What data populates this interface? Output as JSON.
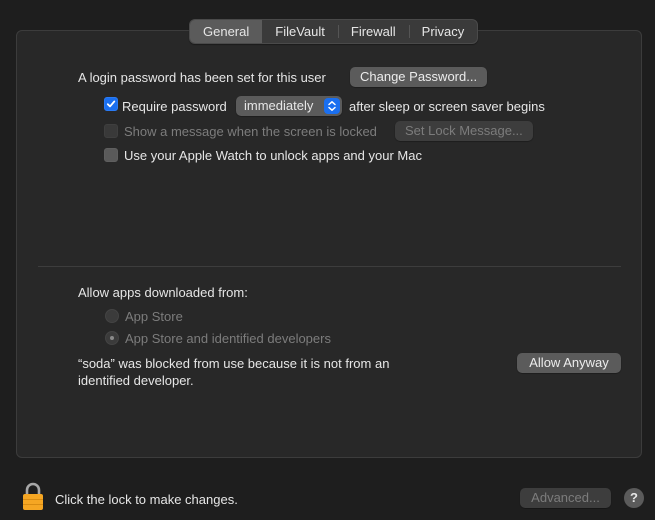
{
  "tabs": [
    {
      "label": "General",
      "active": true
    },
    {
      "label": "FileVault",
      "active": false
    },
    {
      "label": "Firewall",
      "active": false
    },
    {
      "label": "Privacy",
      "active": false
    }
  ],
  "general": {
    "login_password_text": "A login password has been set for this user",
    "change_password_button": "Change Password...",
    "require_password": {
      "label": "Require password",
      "checked": true,
      "interval": "immediately",
      "suffix": "after sleep or screen saver begins"
    },
    "show_message": {
      "label": "Show a message when the screen is locked",
      "checked": false,
      "disabled": true,
      "button": "Set Lock Message..."
    },
    "apple_watch": {
      "label": "Use your Apple Watch to unlock apps and your Mac",
      "checked": false
    }
  },
  "downloads": {
    "heading": "Allow apps downloaded from:",
    "options": [
      {
        "label": "App Store",
        "selected": false
      },
      {
        "label": "App Store and identified developers",
        "selected": true
      }
    ],
    "blocked_message_line1": "“soda” was blocked from use because it is not from an",
    "blocked_message_line2": "identified developer.",
    "allow_button": "Allow Anyway"
  },
  "footer": {
    "lock_text": "Click the lock to make changes.",
    "advanced_button": "Advanced...",
    "help_label": "?"
  },
  "colors": {
    "accent": "#1a6ff0",
    "lock": "#f5a623"
  }
}
